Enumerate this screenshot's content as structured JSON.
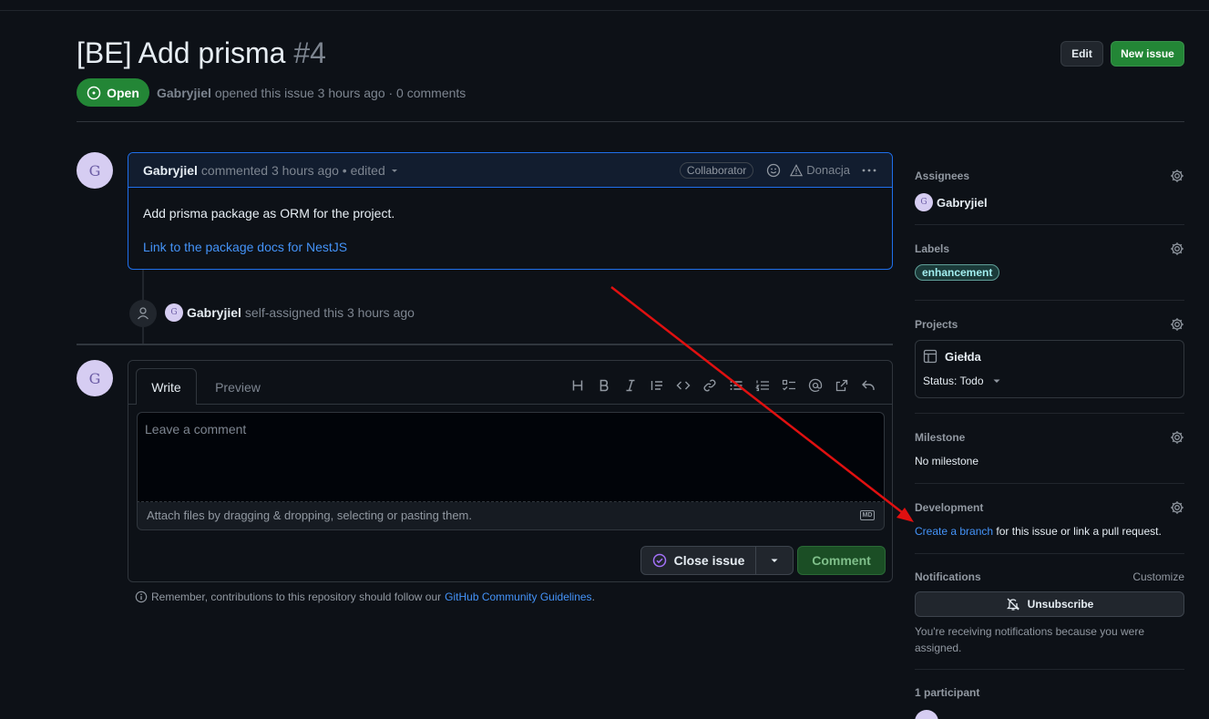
{
  "issue": {
    "title": "[BE] Add prisma",
    "number": "#4",
    "state": "Open",
    "author": "Gabryjiel",
    "meta_text": "opened this issue 3 hours ago · 0 comments"
  },
  "header_buttons": {
    "edit": "Edit",
    "new_issue": "New issue"
  },
  "comment": {
    "avatar_letter": "G",
    "author": "Gabryjiel",
    "meta": "commented 3 hours ago • edited",
    "role_badge": "Collaborator",
    "report": "Donacja",
    "body_text": "Add prisma package as ORM for the project.",
    "link_text": "Link to the package docs for NestJS"
  },
  "event": {
    "avatar_letter": "G",
    "actor": "Gabryjiel",
    "text": "self-assigned this 3 hours ago"
  },
  "composer": {
    "avatar_letter": "G",
    "tab_write": "Write",
    "tab_preview": "Preview",
    "placeholder": "Leave a comment",
    "attach_text": "Attach files by dragging & dropping, selecting or pasting them.",
    "md_badge": "MD",
    "close_issue": "Close issue",
    "comment_button": "Comment"
  },
  "guidelines": {
    "prefix": "Remember, contributions to this repository should follow our",
    "link": "GitHub Community Guidelines",
    "suffix": "."
  },
  "sidebar": {
    "assignees": {
      "heading": "Assignees",
      "name": "Gabryjiel",
      "avatar_letter": "G"
    },
    "labels": {
      "heading": "Labels",
      "label": "enhancement",
      "label_color": "#a2eeef"
    },
    "projects": {
      "heading": "Projects",
      "project_name": "Giełda",
      "status": "Status: Todo"
    },
    "milestone": {
      "heading": "Milestone",
      "value": "No milestone"
    },
    "development": {
      "heading": "Development",
      "link": "Create a branch",
      "text": "for this issue or link a pull request."
    },
    "notifications": {
      "heading": "Notifications",
      "customize": "Customize",
      "button": "Unsubscribe",
      "reason": "You're receiving notifications because you were assigned."
    },
    "participants": {
      "heading": "1 participant"
    }
  },
  "colors": {
    "accent_green": "#238636",
    "link_blue": "#4493f8",
    "annotation_arrow": "#e01010"
  }
}
